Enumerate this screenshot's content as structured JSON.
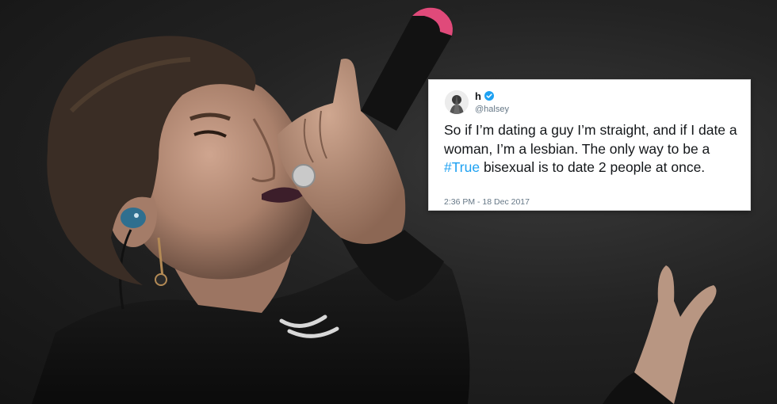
{
  "tweet": {
    "display_name": "h",
    "handle": "@halsey",
    "text_before": "So if I’m dating a guy I’m straight, and if I date a woman, I’m a lesbian. The only way to be a ",
    "hashtag": "#True",
    "text_after": " bisexual is to date 2 people at once.",
    "timestamp": "2:36 PM - 18 Dec 2017",
    "verified_icon": "verified-badge-icon",
    "hashtag_color": "#1da1f2"
  },
  "photo": {
    "icon": "singer-with-microphone-illustration"
  }
}
